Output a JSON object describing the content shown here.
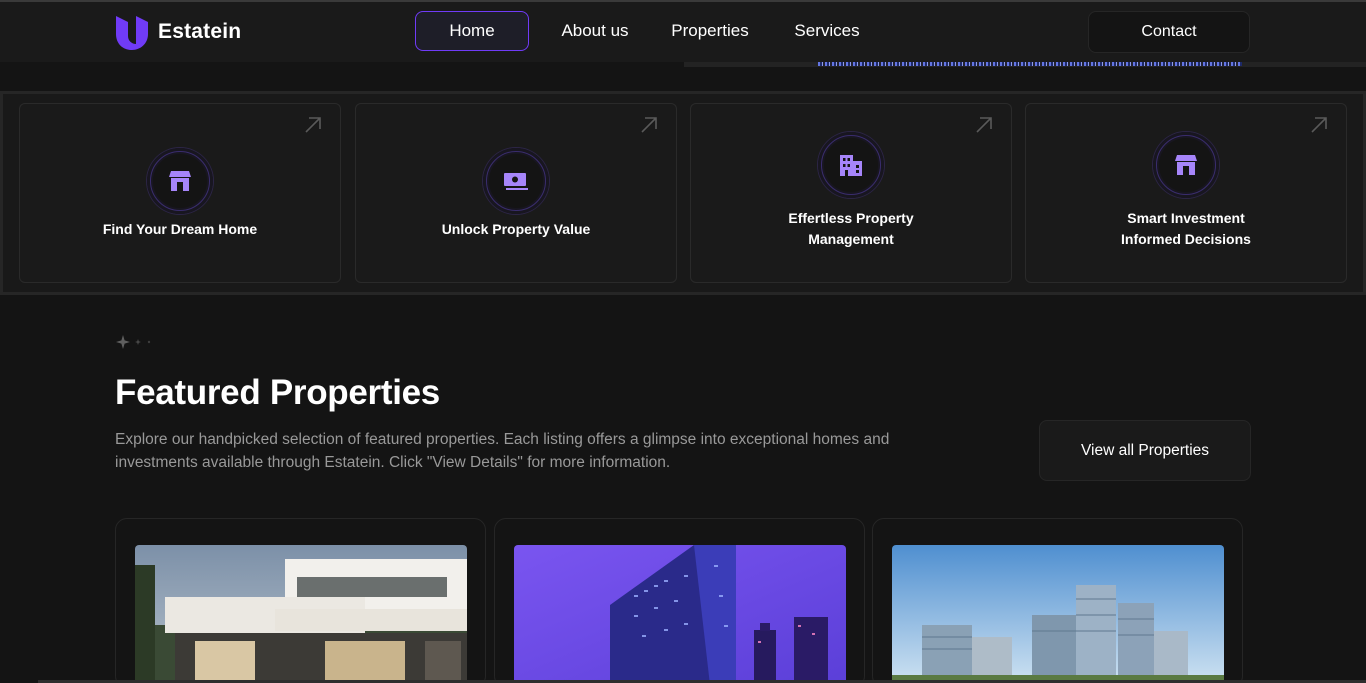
{
  "header": {
    "brand": "Estatein",
    "nav": [
      {
        "label": "Home",
        "active": true
      },
      {
        "label": "About us",
        "active": false
      },
      {
        "label": "Properties",
        "active": false
      },
      {
        "label": "Services",
        "active": false
      }
    ],
    "contact_label": "Contact"
  },
  "features": [
    {
      "label": "Find Your Dream Home",
      "icon": "home-icon"
    },
    {
      "label": "Unlock Property Value",
      "icon": "cash-icon"
    },
    {
      "label": "Effertless Property Management",
      "icon": "building-icon"
    },
    {
      "label": "Smart Investment Informed Decisions",
      "icon": "home-icon"
    }
  ],
  "featured": {
    "title": "Featured Properties",
    "description": "Explore our handpicked selection of featured properties. Each listing offers a glimpse into exceptional homes and investments available through Estatein. Click \"View Details\" for more information.",
    "view_all_label": "View all Properties"
  },
  "properties": [
    {
      "image": "modern-villa-photo"
    },
    {
      "image": "purple-office-tower-photo"
    },
    {
      "image": "city-skyline-photo"
    }
  ],
  "colors": {
    "accent": "#703bf7",
    "background": "#141414",
    "surface": "#1a1a1a",
    "border": "#262626",
    "muted_text": "#999999"
  }
}
